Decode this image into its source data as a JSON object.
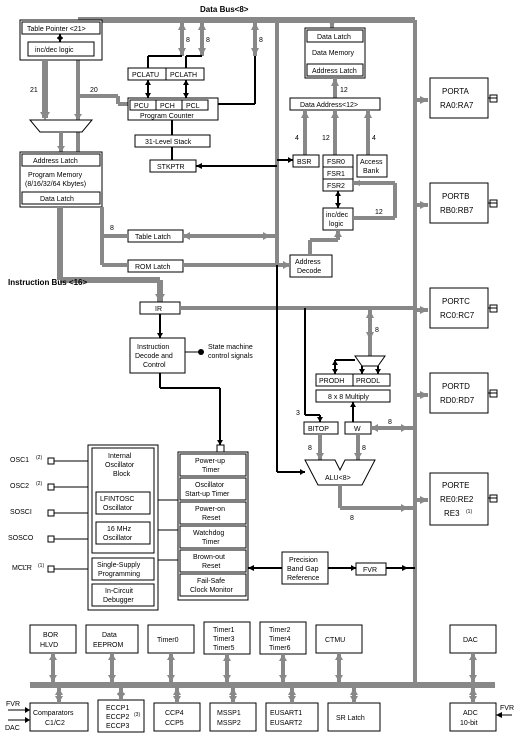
{
  "title": "Data Bus<8>",
  "top": {
    "table_pointer": "Table Pointer <21>",
    "incdec": "inc/dec logic",
    "address_latch": "Address Latch",
    "program_memory": "Program Memory",
    "program_memory_sub": "(8/16/32/64 Kbytes)",
    "data_latch": "Data Latch",
    "data_memory": "Data Memory",
    "address_latch2": "Address Latch",
    "data_address": "Data Address<12>"
  },
  "pc": {
    "pclatu": "PCLATU",
    "pclath": "PCLATH",
    "pcu": "PCU",
    "pch": "PCH",
    "pcl": "PCL",
    "label": "Program Counter",
    "stack": "31-Level Stack",
    "stkptr": "STKPTR"
  },
  "regs": {
    "bsr": "BSR",
    "fsr0": "FSR0",
    "fsr1": "FSR1",
    "fsr2": "FSR2",
    "access": "Access",
    "bank": "Bank",
    "incdec": "inc/dec",
    "logic": "logic"
  },
  "mid": {
    "table_latch": "Table Latch",
    "rom_latch": "ROM Latch",
    "instr_bus": "Instruction Bus <16>",
    "ir": "IR",
    "idc": "Instruction",
    "idc2": "Decode and",
    "idc3": "Control",
    "sm1": "State machine",
    "sm2": "control signals",
    "addr_decode": "Address",
    "addr_decode2": "Decode"
  },
  "alu": {
    "prodh": "PRODH",
    "prodl": "PRODL",
    "mult": "8 x 8 Multiply",
    "bitop": "BITOP",
    "w": "W",
    "alu": "ALU<8>"
  },
  "osc": {
    "osc1": "OSC1",
    "osc2": "OSC2",
    "sosci": "SOSCI",
    "sosco": "SOSCO",
    "mclr": "MCLR",
    "internal": "Internal",
    "oscblock": "Oscillator",
    "block": "Block",
    "lfint": "LFINTOSC",
    "oscillator": "Oscillator",
    "m16": "16 MHz",
    "ssp1": "Single-Supply",
    "ssp2": "Programming",
    "icd1": "In-Circuit",
    "icd2": "Debugger"
  },
  "timers": {
    "put": "Power-up",
    "timer": "Timer",
    "ost1": "Oscillator",
    "ost2": "Start-up Timer",
    "por1": "Power-on",
    "por2": "Reset",
    "wdt1": "Watchdog",
    "wdt2": "Timer",
    "bor1": "Brown-out",
    "bor2": "Reset",
    "fscm1": "Fail-Safe",
    "fscm2": "Clock Monitor",
    "pbg1": "Precision",
    "pbg2": "Band Gap",
    "pbg3": "Reference",
    "fvr": "FVR"
  },
  "ports": {
    "porta": "PORTA",
    "ra": "RA0:RA7",
    "portb": "PORTB",
    "rb": "RB0:RB7",
    "portc": "PORTC",
    "rc": "RC0:RC7",
    "portd": "PORTD",
    "rd": "RD0:RD7",
    "porte": "PORTE",
    "re": "RE0:RE2",
    "re3": "RE3"
  },
  "periph": {
    "bor": "BOR",
    "hlvd": "HLVD",
    "eeprom1": "Data",
    "eeprom2": "EEPROM",
    "timer0": "Timer0",
    "t135a": "Timer1",
    "t135b": "Timer3",
    "t135c": "Timer5",
    "t246a": "Timer2",
    "t246b": "Timer4",
    "t246c": "Timer6",
    "ctmu": "CTMU",
    "dac": "DAC",
    "fvrdac1": "FVR",
    "fvrdac2": "DAC",
    "comp1": "Comparators",
    "comp2": "C1/C2",
    "eccp1": "ECCP1",
    "eccp2": "ECCP2",
    "eccp3": "ECCP3",
    "ccp4": "CCP4",
    "ccp5": "CCP5",
    "mssp1": "MSSP1",
    "mssp2": "MSSP2",
    "eusart1": "EUSART1",
    "eusart2": "EUSART2",
    "sr": "SR Latch",
    "adc1": "ADC",
    "adc2": "10-bit",
    "fvr": "FVR"
  },
  "nums": {
    "n21": "21",
    "n20": "20",
    "n8": "8",
    "n12": "12",
    "n4": "4",
    "n3": "3",
    "note1": "(1)",
    "note2": "(2)",
    "note3": "(3)"
  }
}
